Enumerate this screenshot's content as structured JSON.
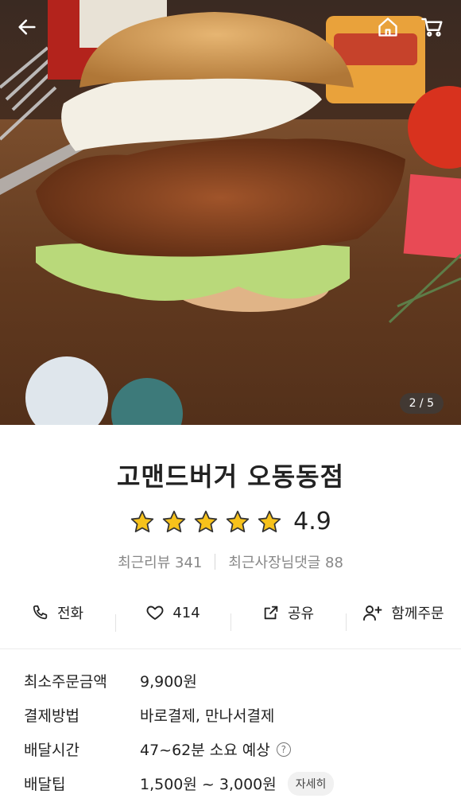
{
  "hero": {
    "image_desc_icon": "fried-chicken-burger-photo",
    "counter": "2 / 5"
  },
  "topbar": {
    "back_icon": "arrow-left-icon",
    "home_icon": "home-icon",
    "cart_icon": "cart-icon"
  },
  "store": {
    "name": "고맨드버거 오동동점",
    "rating": "4.9",
    "stars": 5,
    "recent_reviews": "최근리뷰 341",
    "owner_replies": "최근사장님댓글 88"
  },
  "actions": [
    {
      "label": "전화",
      "icon": "phone-icon"
    },
    {
      "label": "414",
      "icon": "heart-icon"
    },
    {
      "label": "공유",
      "icon": "share-icon"
    },
    {
      "label": "함께주문",
      "icon": "add-user-icon"
    }
  ],
  "details": {
    "min_order_label": "최소주문금액",
    "min_order_value": "9,900원",
    "payment_label": "결제방법",
    "payment_value": "바로결제, 만나서결제",
    "delivery_time_label": "배달시간",
    "delivery_time_value": "47~62분 소요 예상",
    "delivery_tip_label": "배달팁",
    "delivery_tip_value": "1,500원 ~ 3,000원",
    "more_label": "자세히"
  },
  "colors": {
    "star": "#f7c21b",
    "star_stroke": "#333333"
  }
}
